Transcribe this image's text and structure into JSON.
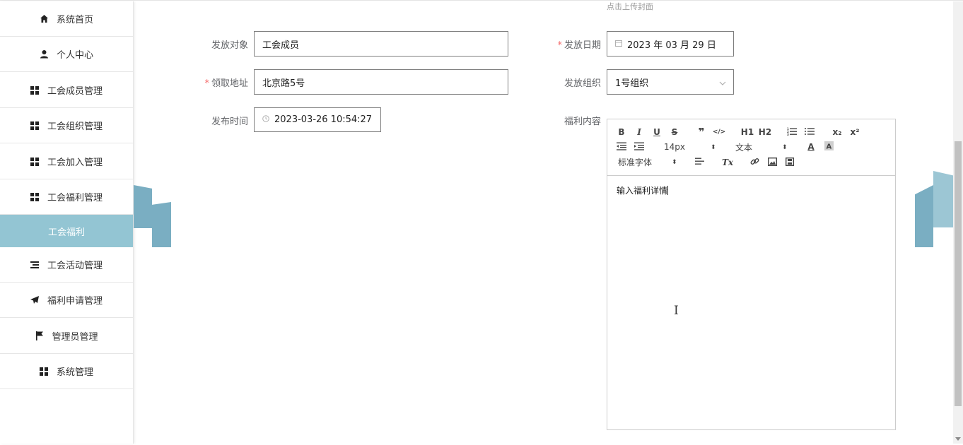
{
  "sidebar": {
    "items": [
      {
        "label": "系统首页",
        "icon": "home-icon"
      },
      {
        "label": "个人中心",
        "icon": "user-icon"
      },
      {
        "label": "工会成员管理",
        "icon": "grid-icon"
      },
      {
        "label": "工会组织管理",
        "icon": "grid-icon"
      },
      {
        "label": "工会加入管理",
        "icon": "grid-icon"
      },
      {
        "label": "工会福利管理",
        "icon": "grid-icon"
      },
      {
        "label": "工会活动管理",
        "icon": "list-icon"
      },
      {
        "label": "福利申请管理",
        "icon": "send-icon"
      },
      {
        "label": "管理员管理",
        "icon": "flag-icon"
      },
      {
        "label": "系统管理",
        "icon": "grid-icon"
      }
    ],
    "active_sub": "工会福利",
    "active_color": "#93c5d3"
  },
  "form": {
    "upload_hint": "点击上传封面",
    "target_label": "发放对象",
    "target_value": "工会成员",
    "date_label": "发放日期",
    "date_value": "2023 年 03 月 29 日",
    "address_label": "领取地址",
    "address_value": "北京路5号",
    "org_label": "发放组织",
    "org_value": "1号组织",
    "publish_label": "发布时间",
    "publish_value": "2023-03-26 10:54:27",
    "content_label": "福利内容"
  },
  "editor": {
    "font_size": "14px",
    "header_select": "文本",
    "font_family": "标准字体",
    "h1": "H1",
    "h2": "H2",
    "sub": "x₂",
    "sup": "x²",
    "bold": "B",
    "italic": "I",
    "underline": "U",
    "strike": "S",
    "quote": "❞",
    "code": "</>",
    "color": "A",
    "clean": "Tx",
    "content": "输入福利详情"
  },
  "colors": {
    "required": "#f56c6c",
    "deco": "#7aaec2"
  }
}
